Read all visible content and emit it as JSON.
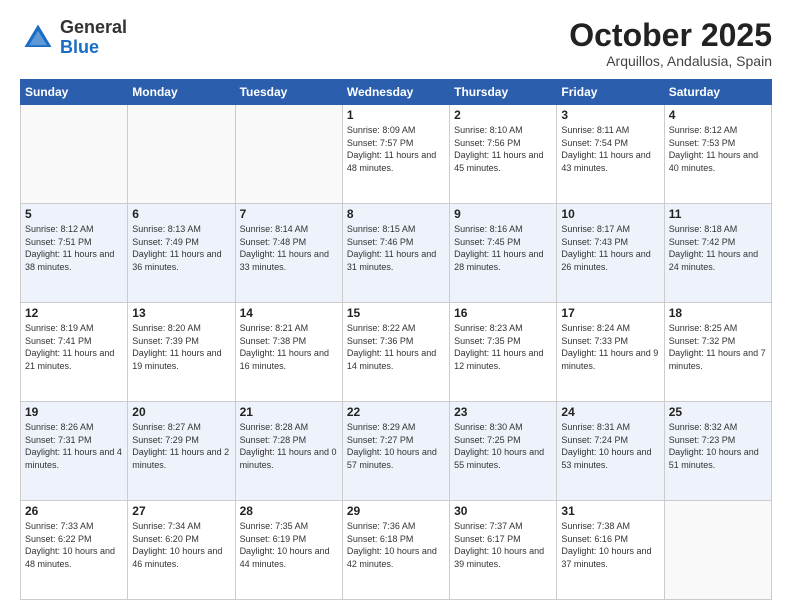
{
  "header": {
    "logo_general": "General",
    "logo_blue": "Blue",
    "month": "October 2025",
    "location": "Arquillos, Andalusia, Spain"
  },
  "days_of_week": [
    "Sunday",
    "Monday",
    "Tuesday",
    "Wednesday",
    "Thursday",
    "Friday",
    "Saturday"
  ],
  "weeks": [
    [
      {
        "day": "",
        "info": ""
      },
      {
        "day": "",
        "info": ""
      },
      {
        "day": "",
        "info": ""
      },
      {
        "day": "1",
        "info": "Sunrise: 8:09 AM\nSunset: 7:57 PM\nDaylight: 11 hours and 48 minutes."
      },
      {
        "day": "2",
        "info": "Sunrise: 8:10 AM\nSunset: 7:56 PM\nDaylight: 11 hours and 45 minutes."
      },
      {
        "day": "3",
        "info": "Sunrise: 8:11 AM\nSunset: 7:54 PM\nDaylight: 11 hours and 43 minutes."
      },
      {
        "day": "4",
        "info": "Sunrise: 8:12 AM\nSunset: 7:53 PM\nDaylight: 11 hours and 40 minutes."
      }
    ],
    [
      {
        "day": "5",
        "info": "Sunrise: 8:12 AM\nSunset: 7:51 PM\nDaylight: 11 hours and 38 minutes."
      },
      {
        "day": "6",
        "info": "Sunrise: 8:13 AM\nSunset: 7:49 PM\nDaylight: 11 hours and 36 minutes."
      },
      {
        "day": "7",
        "info": "Sunrise: 8:14 AM\nSunset: 7:48 PM\nDaylight: 11 hours and 33 minutes."
      },
      {
        "day": "8",
        "info": "Sunrise: 8:15 AM\nSunset: 7:46 PM\nDaylight: 11 hours and 31 minutes."
      },
      {
        "day": "9",
        "info": "Sunrise: 8:16 AM\nSunset: 7:45 PM\nDaylight: 11 hours and 28 minutes."
      },
      {
        "day": "10",
        "info": "Sunrise: 8:17 AM\nSunset: 7:43 PM\nDaylight: 11 hours and 26 minutes."
      },
      {
        "day": "11",
        "info": "Sunrise: 8:18 AM\nSunset: 7:42 PM\nDaylight: 11 hours and 24 minutes."
      }
    ],
    [
      {
        "day": "12",
        "info": "Sunrise: 8:19 AM\nSunset: 7:41 PM\nDaylight: 11 hours and 21 minutes."
      },
      {
        "day": "13",
        "info": "Sunrise: 8:20 AM\nSunset: 7:39 PM\nDaylight: 11 hours and 19 minutes."
      },
      {
        "day": "14",
        "info": "Sunrise: 8:21 AM\nSunset: 7:38 PM\nDaylight: 11 hours and 16 minutes."
      },
      {
        "day": "15",
        "info": "Sunrise: 8:22 AM\nSunset: 7:36 PM\nDaylight: 11 hours and 14 minutes."
      },
      {
        "day": "16",
        "info": "Sunrise: 8:23 AM\nSunset: 7:35 PM\nDaylight: 11 hours and 12 minutes."
      },
      {
        "day": "17",
        "info": "Sunrise: 8:24 AM\nSunset: 7:33 PM\nDaylight: 11 hours and 9 minutes."
      },
      {
        "day": "18",
        "info": "Sunrise: 8:25 AM\nSunset: 7:32 PM\nDaylight: 11 hours and 7 minutes."
      }
    ],
    [
      {
        "day": "19",
        "info": "Sunrise: 8:26 AM\nSunset: 7:31 PM\nDaylight: 11 hours and 4 minutes."
      },
      {
        "day": "20",
        "info": "Sunrise: 8:27 AM\nSunset: 7:29 PM\nDaylight: 11 hours and 2 minutes."
      },
      {
        "day": "21",
        "info": "Sunrise: 8:28 AM\nSunset: 7:28 PM\nDaylight: 11 hours and 0 minutes."
      },
      {
        "day": "22",
        "info": "Sunrise: 8:29 AM\nSunset: 7:27 PM\nDaylight: 10 hours and 57 minutes."
      },
      {
        "day": "23",
        "info": "Sunrise: 8:30 AM\nSunset: 7:25 PM\nDaylight: 10 hours and 55 minutes."
      },
      {
        "day": "24",
        "info": "Sunrise: 8:31 AM\nSunset: 7:24 PM\nDaylight: 10 hours and 53 minutes."
      },
      {
        "day": "25",
        "info": "Sunrise: 8:32 AM\nSunset: 7:23 PM\nDaylight: 10 hours and 51 minutes."
      }
    ],
    [
      {
        "day": "26",
        "info": "Sunrise: 7:33 AM\nSunset: 6:22 PM\nDaylight: 10 hours and 48 minutes."
      },
      {
        "day": "27",
        "info": "Sunrise: 7:34 AM\nSunset: 6:20 PM\nDaylight: 10 hours and 46 minutes."
      },
      {
        "day": "28",
        "info": "Sunrise: 7:35 AM\nSunset: 6:19 PM\nDaylight: 10 hours and 44 minutes."
      },
      {
        "day": "29",
        "info": "Sunrise: 7:36 AM\nSunset: 6:18 PM\nDaylight: 10 hours and 42 minutes."
      },
      {
        "day": "30",
        "info": "Sunrise: 7:37 AM\nSunset: 6:17 PM\nDaylight: 10 hours and 39 minutes."
      },
      {
        "day": "31",
        "info": "Sunrise: 7:38 AM\nSunset: 6:16 PM\nDaylight: 10 hours and 37 minutes."
      },
      {
        "day": "",
        "info": ""
      }
    ]
  ]
}
